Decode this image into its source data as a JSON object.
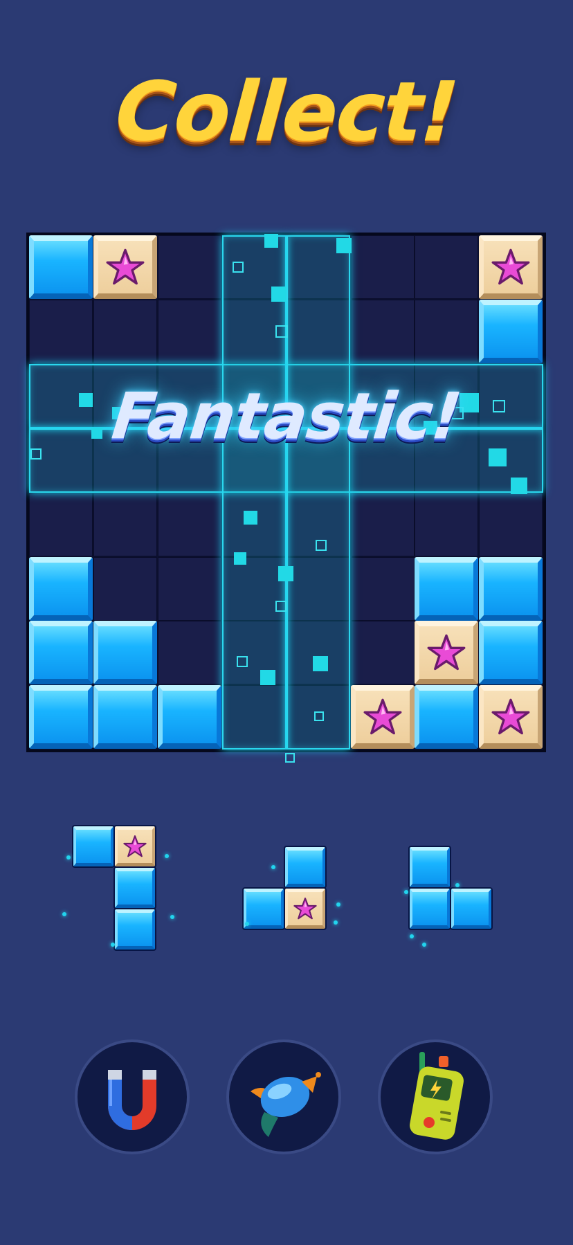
{
  "header": {
    "title": "Collect!"
  },
  "popup": {
    "text": "Fantastic!"
  },
  "board": {
    "size": 8,
    "blocks": [
      {
        "r": 0,
        "c": 0,
        "t": "blue"
      },
      {
        "r": 0,
        "c": 1,
        "t": "star"
      },
      {
        "r": 0,
        "c": 7,
        "t": "star"
      },
      {
        "r": 1,
        "c": 7,
        "t": "blue"
      },
      {
        "r": 5,
        "c": 0,
        "t": "blue"
      },
      {
        "r": 5,
        "c": 6,
        "t": "blue"
      },
      {
        "r": 5,
        "c": 7,
        "t": "blue"
      },
      {
        "r": 6,
        "c": 0,
        "t": "blue"
      },
      {
        "r": 6,
        "c": 1,
        "t": "blue"
      },
      {
        "r": 6,
        "c": 6,
        "t": "star"
      },
      {
        "r": 6,
        "c": 7,
        "t": "blue"
      },
      {
        "r": 7,
        "c": 0,
        "t": "blue"
      },
      {
        "r": 7,
        "c": 1,
        "t": "blue"
      },
      {
        "r": 7,
        "c": 2,
        "t": "blue"
      },
      {
        "r": 7,
        "c": 5,
        "t": "star"
      },
      {
        "r": 7,
        "c": 6,
        "t": "blue"
      },
      {
        "r": 7,
        "c": 7,
        "t": "star"
      }
    ],
    "cleared_rows": [
      2,
      3
    ],
    "cleared_cols": [
      3,
      4
    ]
  },
  "pieces": [
    {
      "name": "piece-1",
      "blocks": [
        {
          "r": 0,
          "c": 0,
          "t": "blue"
        },
        {
          "r": 0,
          "c": 1,
          "t": "star"
        },
        {
          "r": 1,
          "c": 1,
          "t": "blue"
        },
        {
          "r": 2,
          "c": 1,
          "t": "blue"
        }
      ]
    },
    {
      "name": "piece-2",
      "blocks": [
        {
          "r": 0,
          "c": 1,
          "t": "blue"
        },
        {
          "r": 1,
          "c": 0,
          "t": "blue"
        },
        {
          "r": 1,
          "c": 1,
          "t": "star"
        }
      ]
    },
    {
      "name": "piece-3",
      "blocks": [
        {
          "r": 0,
          "c": 0,
          "t": "blue"
        },
        {
          "r": 1,
          "c": 0,
          "t": "blue"
        },
        {
          "r": 1,
          "c": 1,
          "t": "blue"
        }
      ]
    }
  ],
  "boosters": [
    {
      "name": "magnet-booster",
      "icon": "magnet-icon"
    },
    {
      "name": "rocket-booster",
      "icon": "rocket-icon"
    },
    {
      "name": "walkie-talkie-booster",
      "icon": "walkie-talkie-icon"
    }
  ],
  "colors": {
    "background": "#2b3a73",
    "title": "#ffd43b",
    "block_blue": "#19b4ff",
    "block_tan": "#eecf9d",
    "star": "#e94bd6",
    "glow": "#2ad7ee"
  }
}
